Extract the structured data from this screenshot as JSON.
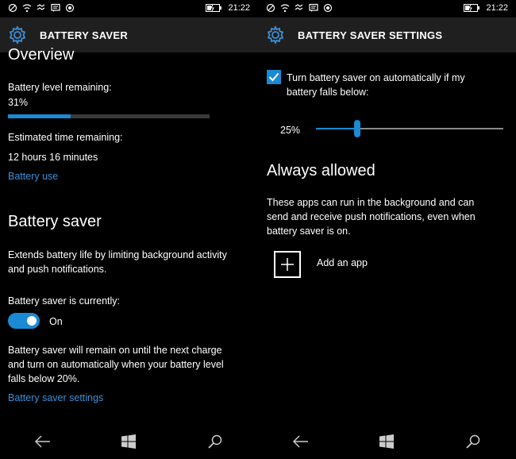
{
  "left": {
    "status_time": "21:22",
    "header_title": "BATTERY SAVER",
    "overview_heading": "Overview",
    "level_label": "Battery level remaining:",
    "level_value": "31%",
    "level_fraction": 0.31,
    "time_label": "Estimated time remaining:",
    "time_value": "12 hours 16 minutes",
    "battery_use_link": "Battery use",
    "saver_heading": "Battery saver",
    "saver_desc_1": "Extends battery life by limiting background activity",
    "saver_desc_2": "and push notifications.",
    "currently_label": "Battery saver is currently:",
    "toggle_state": "On",
    "remain_1": "Battery saver will remain on until the next charge",
    "remain_2": "and turn on automatically when your battery level",
    "remain_3": "falls below 20%.",
    "settings_link": "Battery saver settings"
  },
  "right": {
    "status_time": "21:22",
    "header_title": "BATTERY SAVER SETTINGS",
    "checkbox_label_1": "Turn battery saver on automatically if my",
    "checkbox_label_2": "battery falls below:",
    "checkbox_checked": true,
    "slider_value_label": "25%",
    "slider_fraction": 0.22,
    "allowed_heading": "Always allowed",
    "allowed_desc_1": "These apps can run in the background and can",
    "allowed_desc_2": "send and receive push notifications, even when",
    "allowed_desc_3": "battery saver is on.",
    "add_app_label": "Add an app"
  },
  "colors": {
    "accent": "#1a8ad4",
    "link": "#3d8fd6",
    "header_bg": "#1f1f1f",
    "background": "#000000"
  },
  "icons": [
    "signal-icon",
    "wifi-icon",
    "message-icon",
    "location-icon",
    "battery-charging-icon",
    "gear-icon",
    "back-icon",
    "windows-icon",
    "search-icon",
    "plus-icon",
    "checkmark-icon"
  ]
}
